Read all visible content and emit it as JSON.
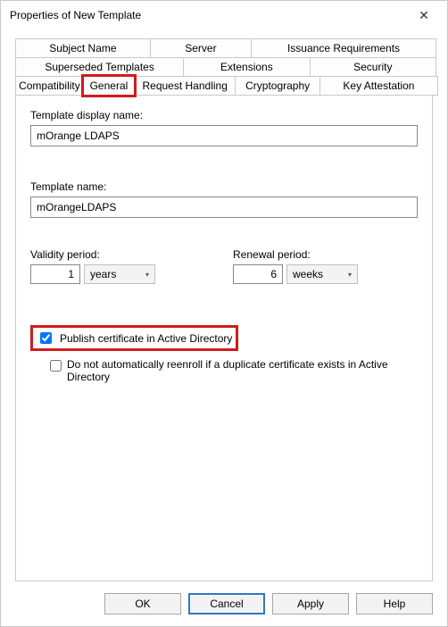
{
  "window": {
    "title": "Properties of New Template"
  },
  "tabs": {
    "row1": [
      "Subject Name",
      "Server",
      "Issuance Requirements"
    ],
    "row2": [
      "Superseded Templates",
      "Extensions",
      "Security"
    ],
    "row3": [
      "Compatibility",
      "General",
      "Request Handling",
      "Cryptography",
      "Key Attestation"
    ]
  },
  "general": {
    "display_name_label": "Template display name:",
    "display_name_value": "mOrange LDAPS",
    "template_name_label": "Template name:",
    "template_name_value": "mOrangeLDAPS",
    "validity_label": "Validity period:",
    "validity_value": "1",
    "validity_unit": "years",
    "renewal_label": "Renewal period:",
    "renewal_value": "6",
    "renewal_unit": "weeks",
    "publish_label": "Publish certificate in Active Directory",
    "no_reenroll_label": "Do not automatically reenroll if a duplicate certificate exists in Active Directory"
  },
  "buttons": {
    "ok": "OK",
    "cancel": "Cancel",
    "apply": "Apply",
    "help": "Help"
  }
}
